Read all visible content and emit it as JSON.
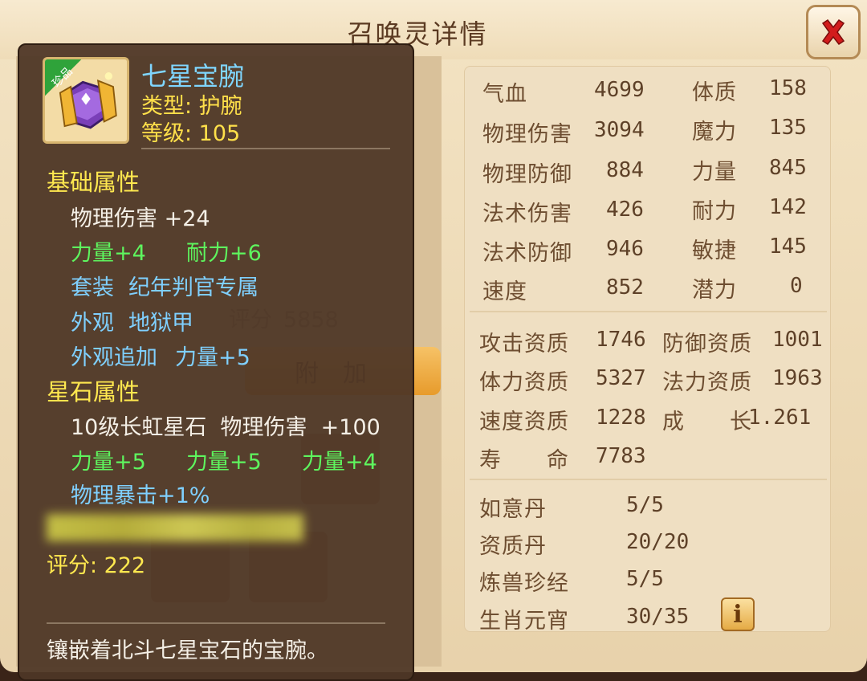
{
  "window": {
    "title": "召唤灵详情"
  },
  "background": {
    "score_label": "评分",
    "score_value": "5858",
    "tab_label": "附加"
  },
  "item": {
    "name": "七星宝腕",
    "badge": "珍品",
    "type": "类型: 护腕",
    "level": "等级: 105",
    "base_title": "基础属性",
    "base_attr": "物理伤害 +24",
    "bonus_1": "力量+4",
    "bonus_2": "耐力+6",
    "set_label": "套装",
    "set_value": "纪年判官专属",
    "look_label": "外观",
    "look_value": "地狱甲",
    "look_extra_label": "外观追加",
    "look_extra_value": "力量+5",
    "star_title": "星石属性",
    "star_line": "10级长虹星石  物理伤害  +100",
    "star_bonus_1": "力量+5",
    "star_bonus_2": "力量+5",
    "star_bonus_3": "力量+4",
    "star_crit": "物理暴击+1%",
    "score": "评分: 222",
    "description": "镶嵌着北斗七星宝石的宝腕。"
  },
  "stats": {
    "basic": [
      {
        "label": "气血",
        "value": "4699"
      },
      {
        "label": "体质",
        "value": "158"
      },
      {
        "label": "物理伤害",
        "value": "3094"
      },
      {
        "label": "魔力",
        "value": "135"
      },
      {
        "label": "物理防御",
        "value": "884"
      },
      {
        "label": "力量",
        "value": "845"
      },
      {
        "label": "法术伤害",
        "value": "426"
      },
      {
        "label": "耐力",
        "value": "142"
      },
      {
        "label": "法术防御",
        "value": "946"
      },
      {
        "label": "敏捷",
        "value": "145"
      },
      {
        "label": "速度",
        "value": "852"
      },
      {
        "label": "潜力",
        "value": "0"
      }
    ],
    "aptitude": [
      {
        "label": "攻击资质",
        "value": "1746"
      },
      {
        "label": "防御资质",
        "value": "1001"
      },
      {
        "label": "体力资质",
        "value": "5327"
      },
      {
        "label": "法力资质",
        "value": "1963"
      },
      {
        "label": "速度资质",
        "value": "1228"
      },
      {
        "label": "成　　长",
        "value": "1.261"
      },
      {
        "label": "寿　　命",
        "value": "7783"
      }
    ],
    "items": [
      {
        "label": "如意丹",
        "value": "5/5"
      },
      {
        "label": "资质丹",
        "value": "20/20"
      },
      {
        "label": "炼兽珍经",
        "value": "5/5"
      },
      {
        "label": "生肖元宵",
        "value": "30/35"
      }
    ],
    "info_icon": "i"
  },
  "colors": {
    "item_name": "#7fd6ff",
    "section_title": "#ffe84f",
    "green_attr": "#5ef55e"
  }
}
